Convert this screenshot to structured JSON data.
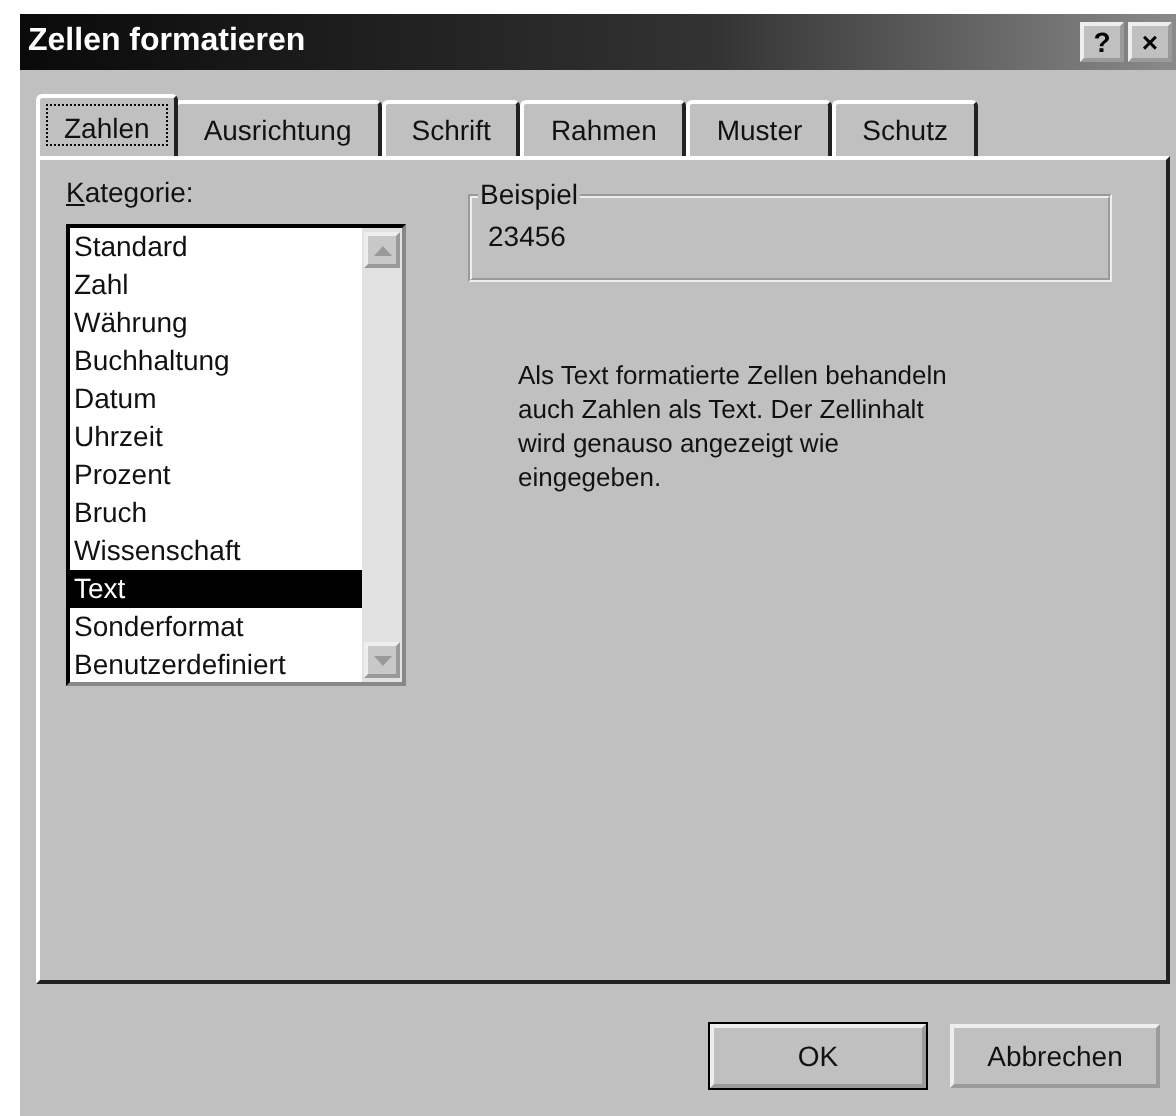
{
  "window": {
    "title": "Zellen formatieren",
    "title_buttons": [
      "?",
      "×"
    ]
  },
  "tabs": [
    {
      "label": "Zahlen",
      "selected": true
    },
    {
      "label": "Ausrichtung",
      "selected": false
    },
    {
      "label": "Schrift",
      "selected": false
    },
    {
      "label": "Rahmen",
      "selected": false
    },
    {
      "label": "Muster",
      "selected": false
    },
    {
      "label": "Schutz",
      "selected": false
    }
  ],
  "category": {
    "label": "Kategorie:",
    "items": [
      {
        "label": "Standard",
        "selected": false
      },
      {
        "label": "Zahl",
        "selected": false
      },
      {
        "label": "Währung",
        "selected": false
      },
      {
        "label": "Buchhaltung",
        "selected": false
      },
      {
        "label": "Datum",
        "selected": false
      },
      {
        "label": "Uhrzeit",
        "selected": false
      },
      {
        "label": "Prozent",
        "selected": false
      },
      {
        "label": "Bruch",
        "selected": false
      },
      {
        "label": "Wissenschaft",
        "selected": false
      },
      {
        "label": "Text",
        "selected": true
      },
      {
        "label": "Sonderformat",
        "selected": false
      },
      {
        "label": "Benutzerdefiniert",
        "selected": false
      }
    ]
  },
  "sample": {
    "label": "Beispiel",
    "value": "23456"
  },
  "description": "Als Text formatierte Zellen behandeln auch Zahlen als Text. Der Zellinhalt wird genauso angezeigt wie eingegeben.",
  "buttons": [
    {
      "label": "OK",
      "default": true
    },
    {
      "label": "Abbrechen",
      "default": false
    }
  ]
}
